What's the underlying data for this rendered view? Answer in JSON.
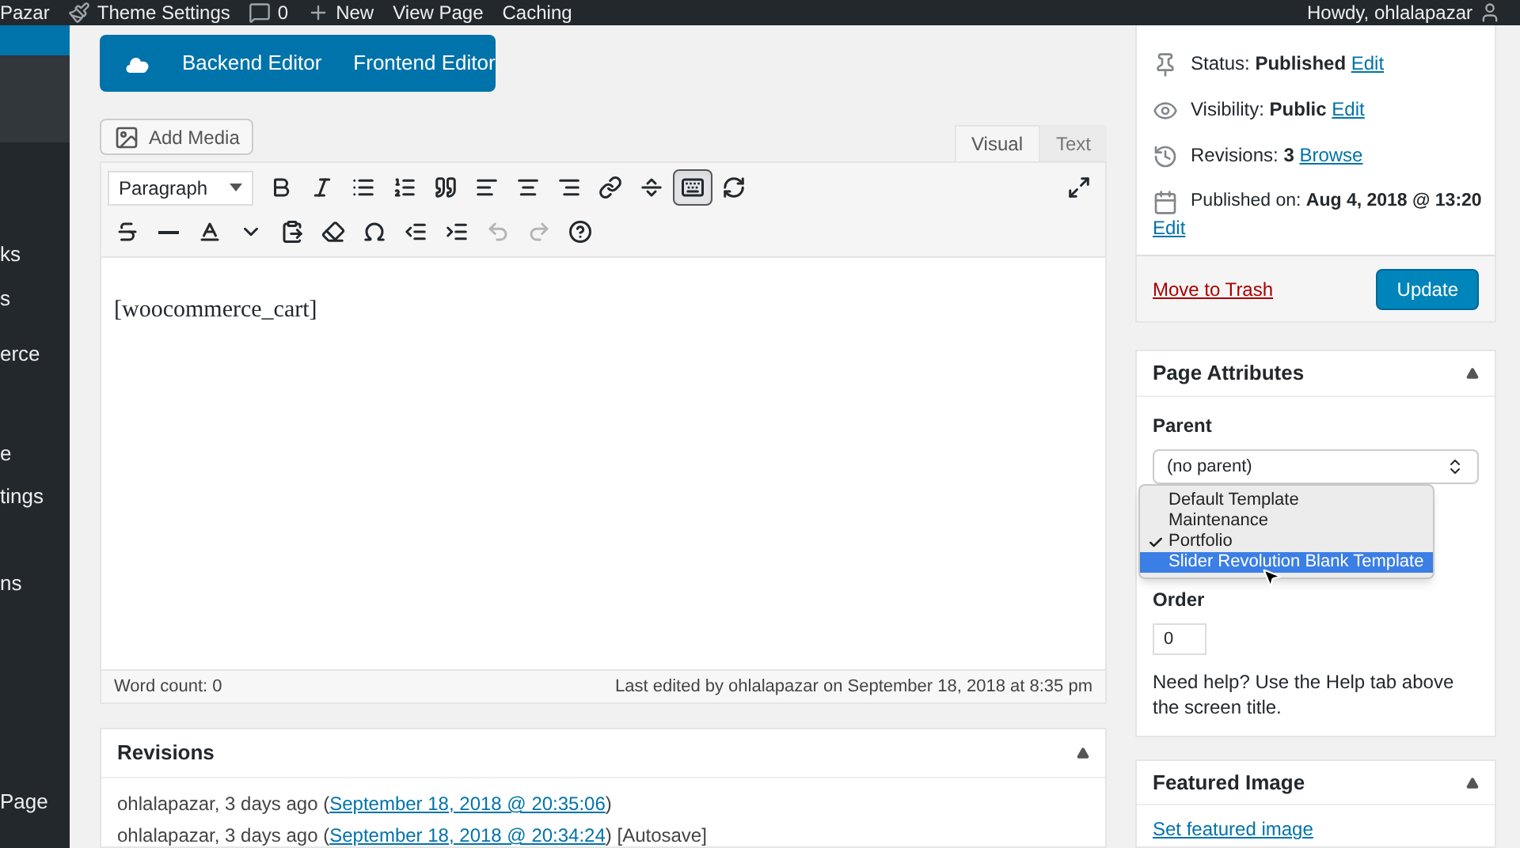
{
  "admin_bar": {
    "items": [
      {
        "kind": "text",
        "label": "Pazar"
      },
      {
        "kind": "settings",
        "label": "Theme Settings"
      },
      {
        "kind": "comments",
        "label": "0"
      },
      {
        "kind": "new",
        "label": "New"
      },
      {
        "kind": "text",
        "label": "View Page"
      },
      {
        "kind": "text",
        "label": "Caching"
      }
    ],
    "greeting": "Howdy, ohlalapazar"
  },
  "sidebar": {
    "items": [
      {
        "label": "ks"
      },
      {
        "label": "s"
      },
      {
        "label": "erce"
      },
      {
        "label": "e"
      },
      {
        "label": "tings"
      },
      {
        "label": "ns"
      },
      {
        "label": "Page"
      }
    ]
  },
  "builder": {
    "buttons": [
      "Backend Editor",
      "Frontend Editor"
    ]
  },
  "editor": {
    "add_media": "Add Media",
    "tabs": [
      {
        "label": "Visual",
        "selected": true
      },
      {
        "label": "Text",
        "selected": false
      }
    ],
    "format": "Paragraph",
    "toolbar_toggle": {
      "pressed": true
    },
    "undo": {
      "disabled": true
    },
    "redo": {
      "disabled": true
    },
    "content": "[woocommerce_cart]",
    "word_count": "Word count: 0",
    "last_edited": "Last edited by ohlalapazar on September 18, 2018 at 8:35 pm"
  },
  "revisions": {
    "title": "Revisions",
    "rows": [
      {
        "text": "ohlalapazar, 3 days ago (",
        "link": "September 18, 2018 @ 20:35:06",
        "suffix": ")"
      },
      {
        "text": "ohlalapazar, 3 days ago (",
        "link": "September 18, 2018 @ 20:34:24",
        "suffix": ") [Autosave]"
      }
    ]
  },
  "publish": {
    "rows": [
      {
        "kind": "status",
        "label": "Status: ",
        "value": "Published",
        "link": "Edit"
      },
      {
        "kind": "visibility",
        "label": "Visibility: ",
        "value": "Public",
        "link": "Edit"
      },
      {
        "kind": "revisions",
        "label": "Revisions: ",
        "value": "3",
        "link": "Browse"
      },
      {
        "kind": "date",
        "label": "Published on: ",
        "value": "Aug 4, 2018 @ 13:20",
        "link": "Edit"
      }
    ],
    "trash": "Move to Trash",
    "update": "Update"
  },
  "page_attributes": {
    "title": "Page Attributes",
    "parent_label": "Parent",
    "parent_value": "(no parent)",
    "template_options": [
      {
        "label": "Default Template",
        "checked": false,
        "selected": false
      },
      {
        "label": "Maintenance",
        "checked": false,
        "selected": false
      },
      {
        "label": "Portfolio",
        "checked": true,
        "selected": false
      },
      {
        "label": "Slider Revolution Blank Template",
        "checked": false,
        "selected": true
      }
    ],
    "order_label": "Order",
    "order_value": "0",
    "help": "Need help? Use the Help tab above the screen title."
  },
  "featured_image": {
    "title": "Featured Image",
    "link": "Set featured image"
  }
}
